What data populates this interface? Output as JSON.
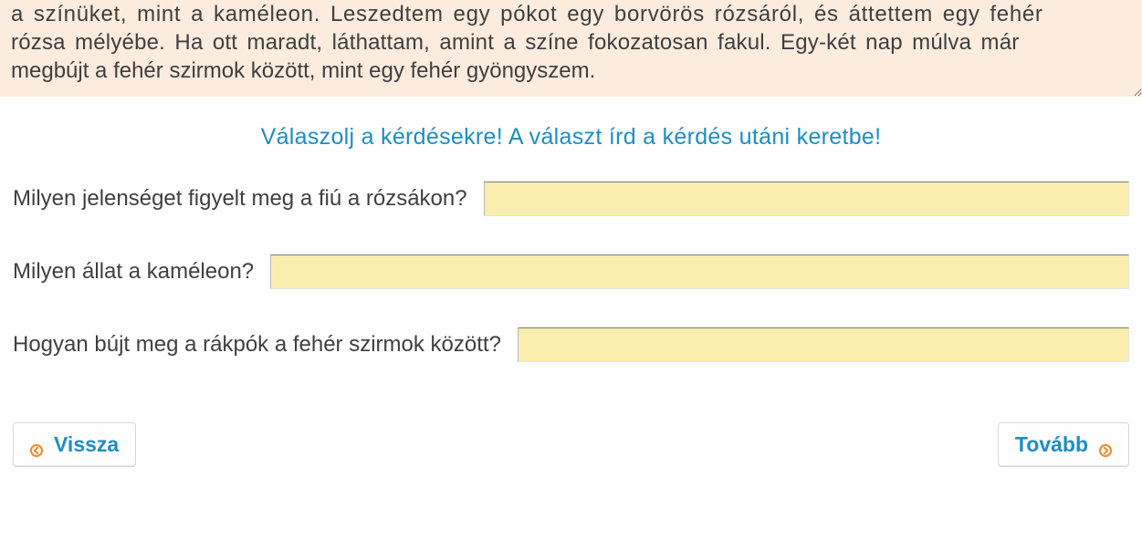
{
  "passage": {
    "line1": "a  színüket,  mint  a  kaméleon.  Leszedtem  egy  pókot  egy  borvörös  rózsáról,  és  áttettem  egy  fehér",
    "line2": "rózsa  mélyébe.  Ha  ott  maradt,  láthattam,  amint  a  színe  fokozatosan  fakul.  Egy-két  nap  múlva  már",
    "line3": "megbújt a fehér szirmok között, mint egy fehér gyöngyszem."
  },
  "instruction": "Válaszolj a kérdésekre! A választ írd a kérdés utáni keretbe!",
  "questions": [
    {
      "label": "Milyen jelenséget figyelt meg a fiú a rózsákon?",
      "value": ""
    },
    {
      "label": "Milyen állat a kaméleon?",
      "value": ""
    },
    {
      "label": "Hogyan bújt meg a rákpók a fehér szirmok között?",
      "value": ""
    }
  ],
  "nav": {
    "back_label": "Vissza",
    "next_label": "Tovább"
  },
  "colors": {
    "accent": "#1f8dc1",
    "passage_bg": "#fbecdd",
    "input_bg": "#fbedae",
    "nav_icon": "#f08a24"
  }
}
